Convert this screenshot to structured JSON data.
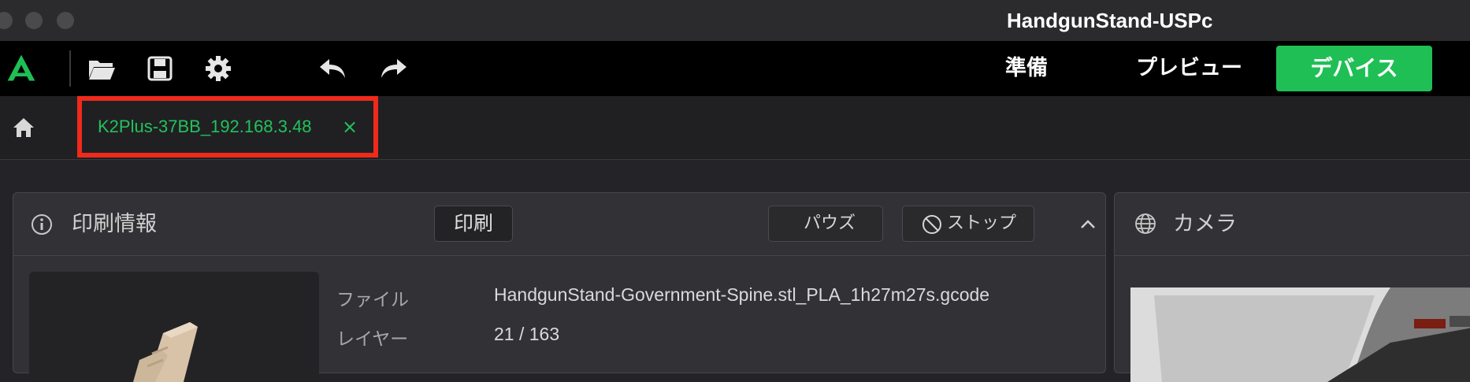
{
  "window": {
    "title": "HandgunStand-USPc"
  },
  "toolbar": {
    "icons": [
      "app-logo-icon",
      "open-folder-icon",
      "save-icon",
      "settings-gear-icon",
      "undo-icon",
      "redo-icon"
    ],
    "nav": {
      "prepare": "準備",
      "preview": "プレビュー",
      "device": "デバイス"
    },
    "accent_color": "#1fbf55"
  },
  "tabs": {
    "home_icon": "home-icon",
    "active": {
      "label": "K2Plus-37BB_192.168.3.48",
      "close": "×"
    },
    "highlight_color": "#ef2a1c"
  },
  "print_panel": {
    "title": "印刷情報",
    "status_button": "印刷",
    "pause_button": "パウズ",
    "stop_button": "ストップ",
    "rows": [
      {
        "label": "ファイル",
        "value": "HandgunStand-Government-Spine.stl_PLA_1h27m27s.gcode"
      },
      {
        "label": "レイヤー",
        "value": "21 / 163"
      }
    ]
  },
  "camera_panel": {
    "title": "カメラ"
  }
}
